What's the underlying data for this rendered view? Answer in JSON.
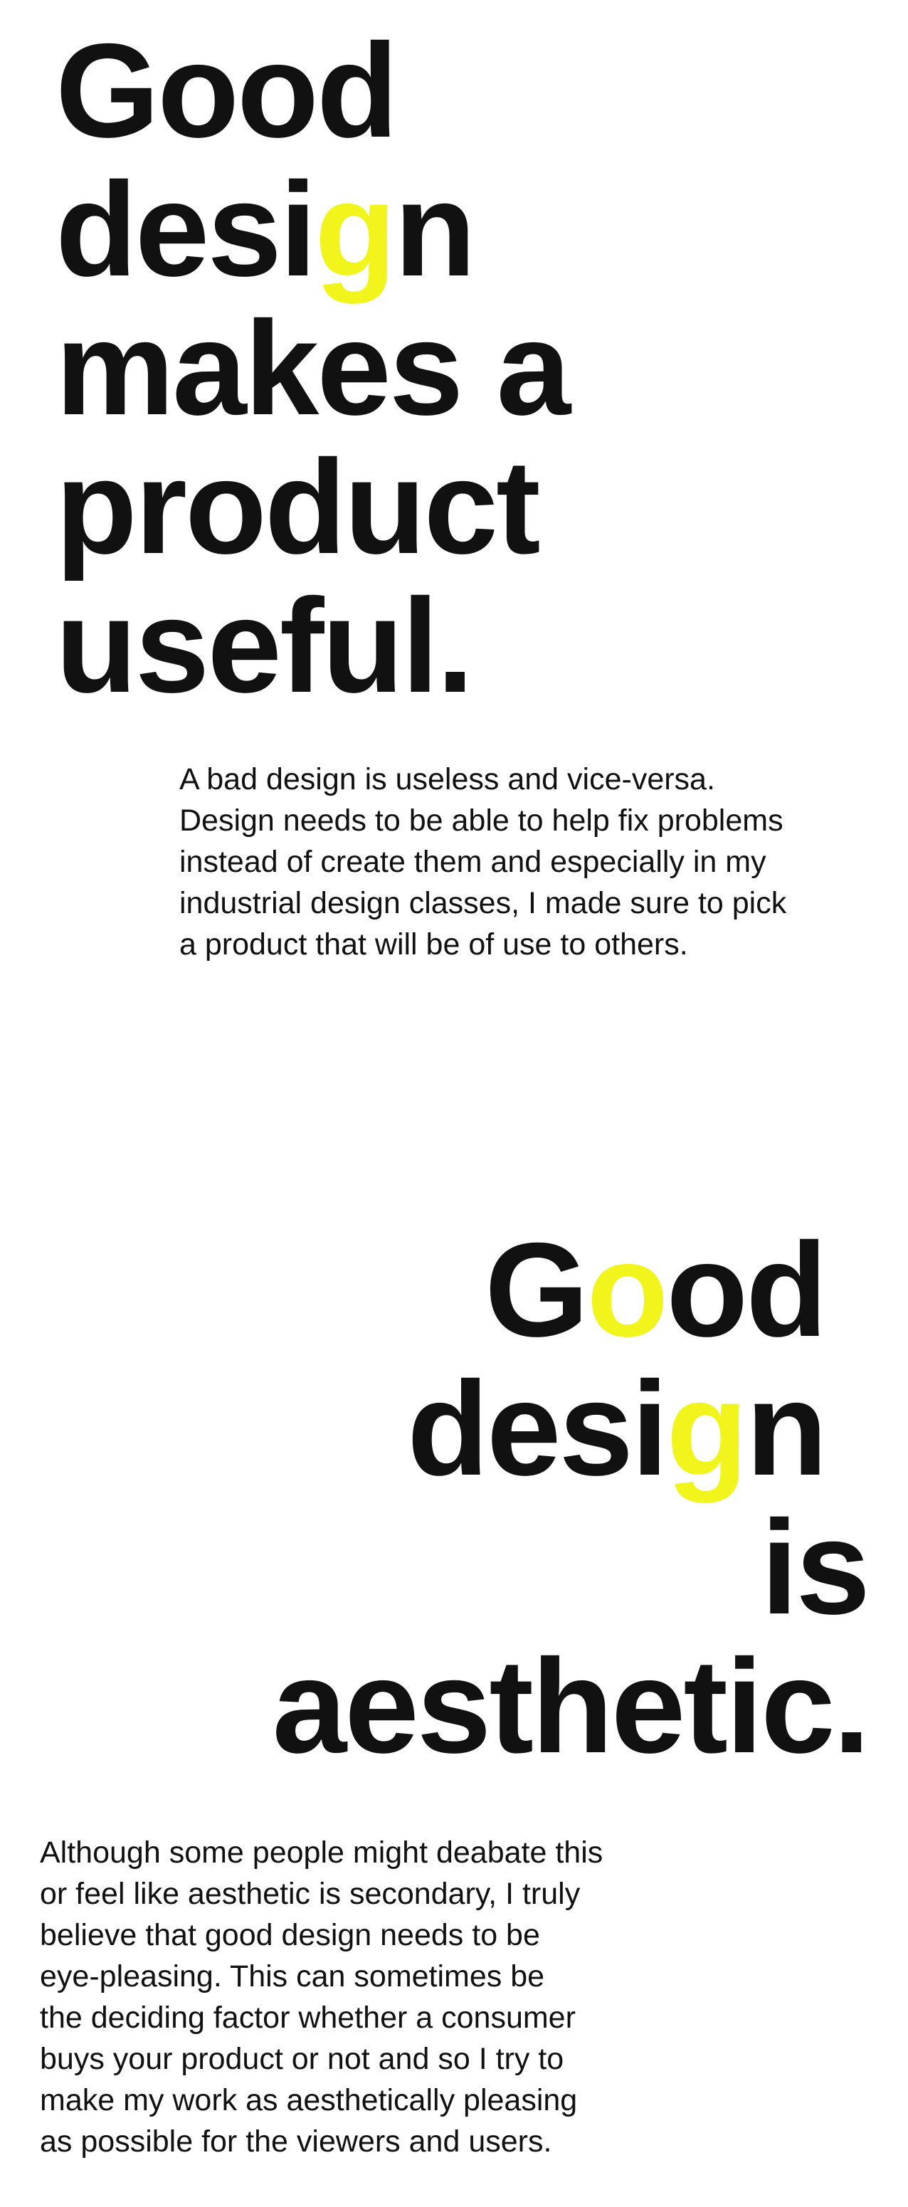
{
  "section_1": {
    "headline": {
      "line1": "Good",
      "line2_pre": "desi",
      "line2_hl": "g",
      "line2_post": "n",
      "line3": "makes a",
      "line4": "product",
      "line5": "useful."
    },
    "body_lines": [
      "A bad design is useless and vice-versa.",
      "Design needs to be able to help fix problems",
      "instead of create them and especially in my",
      "industrial design classes, I made sure to pick",
      "a product that will be of use to others."
    ]
  },
  "section_2": {
    "headline": {
      "line1_pre": "G",
      "line1_hl": "o",
      "line1_post": "od",
      "line2_pre": "desi",
      "line2_hl": "g",
      "line2_post": "n",
      "line3": "is",
      "line4": "aesthetic."
    },
    "body_lines": [
      "Although some people might deabate this",
      "or feel like aesthetic is secondary, I truly",
      "believe that good design needs to be",
      "eye-pleasing. This can sometimes be",
      "the deciding factor whether a consumer",
      "buys your product or not and so I try to",
      "make my work as aesthetically pleasing",
      "as possible for the viewers and users."
    ]
  },
  "colors": {
    "text": "#111111",
    "accent_yellow": "#f2f51c",
    "background": "#ffffff"
  }
}
